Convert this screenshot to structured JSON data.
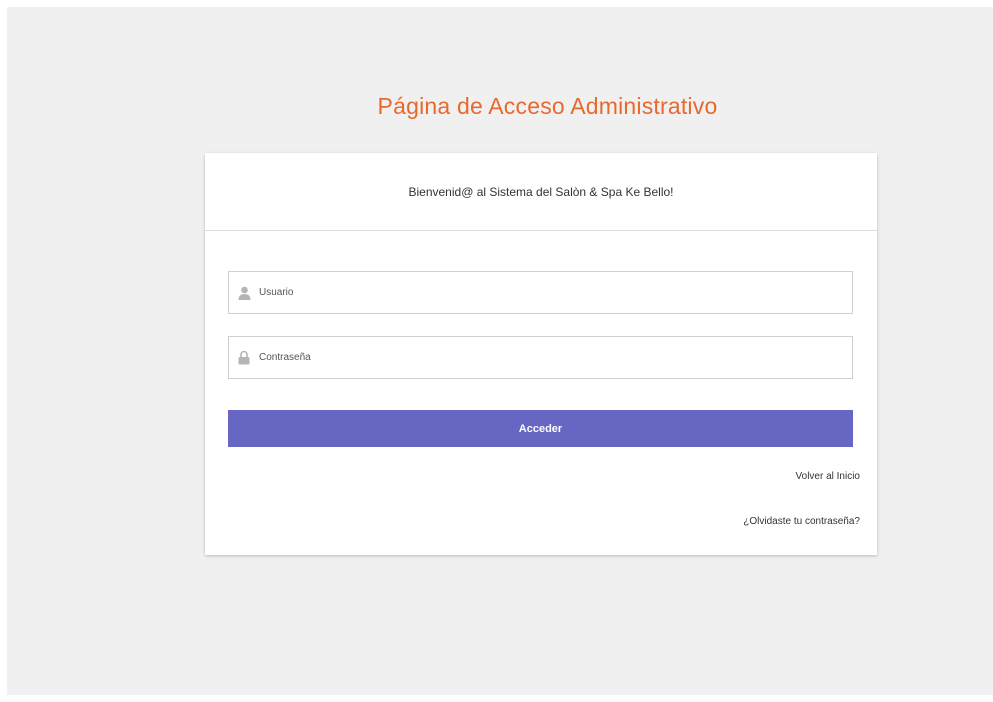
{
  "page": {
    "title": "Página de Acceso Administrativo",
    "background": "#f0f0f0",
    "title_color": "#e8692e"
  },
  "card": {
    "header_text": "Bienvenid@ al Sistema del Salòn & Spa Ke Bello!"
  },
  "form": {
    "username": {
      "placeholder": "Usuario",
      "value": "",
      "icon": "user-icon"
    },
    "password": {
      "placeholder": "Contraseña",
      "value": "",
      "icon": "lock-icon"
    },
    "submit_label": "Acceder",
    "submit_color": "#6766c3"
  },
  "links": {
    "home": "Volver al Inicio",
    "forgot": "¿Olvidaste tu contraseña?"
  }
}
